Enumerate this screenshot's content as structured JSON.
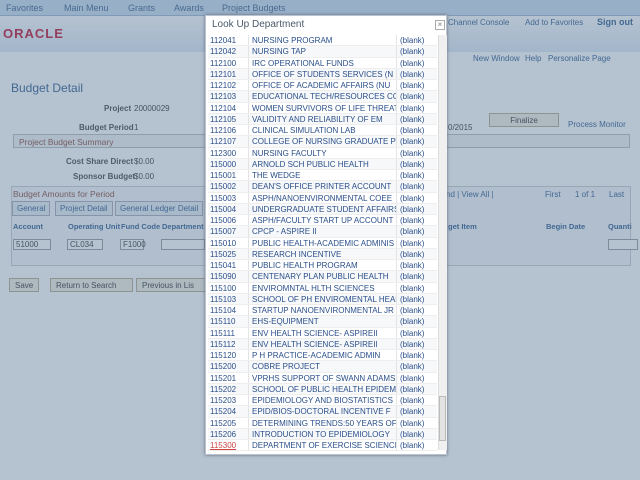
{
  "nav": {
    "favorites": "Favorites",
    "main_menu": "Main Menu",
    "grants": "Grants",
    "awards": "Awards",
    "project_budgets": "Project Budgets"
  },
  "header": {
    "logo": "ORACLE",
    "channel_console": "Channel Console",
    "add_favorites": "Add to Favorites",
    "sign_out": "Sign out",
    "new_window": "New Window",
    "help": "Help",
    "personalize": "Personalize Page"
  },
  "page": {
    "title": "Budget Detail",
    "project_label": "Project",
    "project_value": "20000029",
    "period_label": "Budget Period",
    "period_value": "1",
    "date_fragment": "0/2015",
    "finalize": "Finalize",
    "process_monitor": "Process Monitor",
    "summary": "Project Budget Summary",
    "cost_share_label": "Cost Share Direct",
    "cost_share_value": "$0.00",
    "sponsor_label": "Sponsor Budget",
    "sponsor_value": "$0.00",
    "amounts_title": "Budget Amounts for Period",
    "grid_nav": "nd | View All |",
    "first": "First",
    "page_count": "1 of 1",
    "last": "Last",
    "tabs": [
      "General",
      "Project Detail",
      "General Ledger Detail"
    ],
    "columns": [
      "Account",
      "Operating Unit",
      "Fund Code",
      "Department",
      "get Item",
      "Begin Date",
      "Quanti"
    ],
    "row": {
      "account": "51000",
      "operating_unit": "CL034",
      "fund_code": "F1000"
    },
    "buttons": {
      "save": "Save",
      "return": "Return to Search",
      "previous": "Previous in Lis"
    }
  },
  "modal": {
    "title": "Look Up Department",
    "close": "×",
    "rows": [
      [
        "112041",
        "NURSING PROGRAM",
        "(blank)"
      ],
      [
        "112042",
        "NURSING TAP",
        "(blank)"
      ],
      [
        "112100",
        "IRC OPERATIONAL FUNDS",
        "(blank)"
      ],
      [
        "112101",
        "OFFICE OF STUDENTS SERVICES (N",
        "(blank)"
      ],
      [
        "112102",
        "OFFICE OF ACADEMIC AFFAIRS (NU",
        "(blank)"
      ],
      [
        "112103",
        "EDUCATIONAL TECH/RESOURCES COM",
        "(blank)"
      ],
      [
        "112104",
        "WOMEN SURVIVORS OF LIFE THREAT",
        "(blank)"
      ],
      [
        "112105",
        "VALIDITY AND RELIABILITY OF EM",
        "(blank)"
      ],
      [
        "112106",
        "CLINICAL SIMULATION LAB",
        "(blank)"
      ],
      [
        "112107",
        "COLLEGE OF NURSING GRADUATE PR",
        "(blank)"
      ],
      [
        "112300",
        "NURSING FACULTY",
        "(blank)"
      ],
      [
        "115000",
        "ARNOLD SCH PUBLIC HEALTH",
        "(blank)"
      ],
      [
        "115001",
        "THE WEDGE",
        "(blank)"
      ],
      [
        "115002",
        "DEAN'S OFFICE PRINTER ACCOUNT",
        "(blank)"
      ],
      [
        "115003",
        "ASPH/NANOENVIRONMENTAL COEE",
        "(blank)"
      ],
      [
        "115004",
        "UNDERGRADUATE STUDENT AFFAIRS",
        "(blank)"
      ],
      [
        "115006",
        "ASPH/FACULTY START UP ACCOUNT",
        "(blank)"
      ],
      [
        "115007",
        "CPCP - ASPIRE II",
        "(blank)"
      ],
      [
        "115010",
        "PUBLIC HEALTH-ACADEMIC ADMINIS",
        "(blank)"
      ],
      [
        "115025",
        "RESEARCH INCENTIVE",
        "(blank)"
      ],
      [
        "115041",
        "PUBLIC HEALTH PROGRAM",
        "(blank)"
      ],
      [
        "115090",
        "CENTENARY PLAN PUBLIC HEALTH",
        "(blank)"
      ],
      [
        "115100",
        "ENVIROMNTAL HLTH SCIENCES",
        "(blank)"
      ],
      [
        "115103",
        "SCHOOL OF PH ENVIROMENTAL HEAL",
        "(blank)"
      ],
      [
        "115104",
        "STARTUP NANOENVIRONMENTAL JR F",
        "(blank)"
      ],
      [
        "115110",
        "EHS-EQUIPMENT",
        "(blank)"
      ],
      [
        "115111",
        "ENV HEALTH SCIENCE- ASPIREII",
        "(blank)"
      ],
      [
        "115112",
        "ENV HEALTH SCIENCE- ASPIREII",
        "(blank)"
      ],
      [
        "115120",
        "P H PRACTICE-ACADEMIC ADMIN",
        "(blank)"
      ],
      [
        "115200",
        "COBRE PROJECT",
        "(blank)"
      ],
      [
        "115201",
        "VPRHS SUPPORT OF SWANN ADAMS",
        "(blank)"
      ],
      [
        "115202",
        "SCHOOL OF PUBLIC HEALTH EPIDEM",
        "(blank)"
      ],
      [
        "115203",
        "EPIDEMIOLOGY AND BIOSTATISTICS",
        "(blank)"
      ],
      [
        "115204",
        "EPID/BIOS-DOCTORAL INCENTIVE F",
        "(blank)"
      ],
      [
        "115205",
        "DETERMINING TRENDS:50 YEARS OF",
        "(blank)"
      ],
      [
        "115206",
        "INTRODUCTION TO EPIDEMIOLOGY",
        "(blank)"
      ],
      [
        "115300",
        "DEPARTMENT OF EXERCISE SCIENCE",
        "(blank)"
      ]
    ]
  },
  "colors": {
    "brand": "#c3102f",
    "link": "#2a4f8a"
  }
}
